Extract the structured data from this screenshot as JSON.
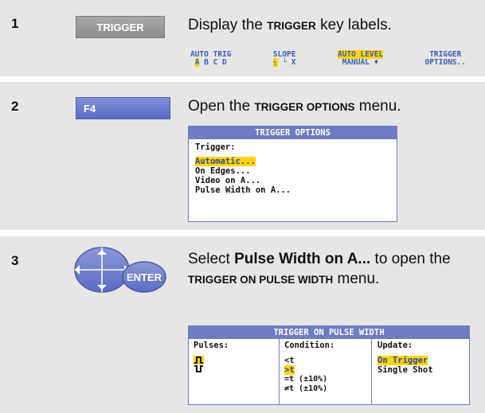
{
  "steps": [
    {
      "num": "1",
      "key": "TRIGGER",
      "instr_pre": "Display the ",
      "instr_sc": "TRIGGER",
      "instr_post": " key labels."
    },
    {
      "num": "2",
      "key": "F4",
      "instr_pre": "Open the ",
      "instr_sc": "TRIGGER OPTIONS",
      "instr_post": " menu."
    },
    {
      "num": "3",
      "key": "ENTER",
      "instr_pre": "Select ",
      "instr_bold": "Pulse Width on A...",
      "instr_mid": " to open the ",
      "instr_sc": "TRIGGER ON PULSE WIDTH",
      "instr_post": " menu."
    }
  ],
  "softkeys": [
    {
      "line1": "AUTO TRIG",
      "line2_hl": "A",
      "line2_rest": " B C D"
    },
    {
      "line1": "SLOPE",
      "line2_hl": "┐",
      "line2_rest": " └  X"
    },
    {
      "line1": "AUTO LEVEL",
      "line1_hl": true,
      "line2": "MANUAL ♦"
    },
    {
      "line1": "TRIGGER",
      "line2": "OPTIONS.."
    }
  ],
  "trigger_options_menu": {
    "title": "TRIGGER OPTIONS",
    "label": "Trigger:",
    "items": [
      "Automatic...",
      "On Edges...",
      "Video on A...",
      "Pulse Width on A..."
    ],
    "selected": "Automatic..."
  },
  "pulse_width_menu": {
    "title": "TRIGGER ON PULSE WIDTH",
    "pulses_header": "Pulses:",
    "condition_header": "Condition:",
    "update_header": "Update:",
    "conditions": [
      "<t",
      ">t",
      "=t (±10%)",
      "≠t (±10%)"
    ],
    "condition_selected": ">t",
    "updates": [
      "On Trigger",
      "Single Shot"
    ],
    "update_selected": "On Trigger"
  },
  "colors": {
    "menu_blue": "#6f7cc4",
    "highlight": "#ffd400",
    "softkey_text": "#3a5fb8",
    "step_bg": "#e6e6e6"
  }
}
